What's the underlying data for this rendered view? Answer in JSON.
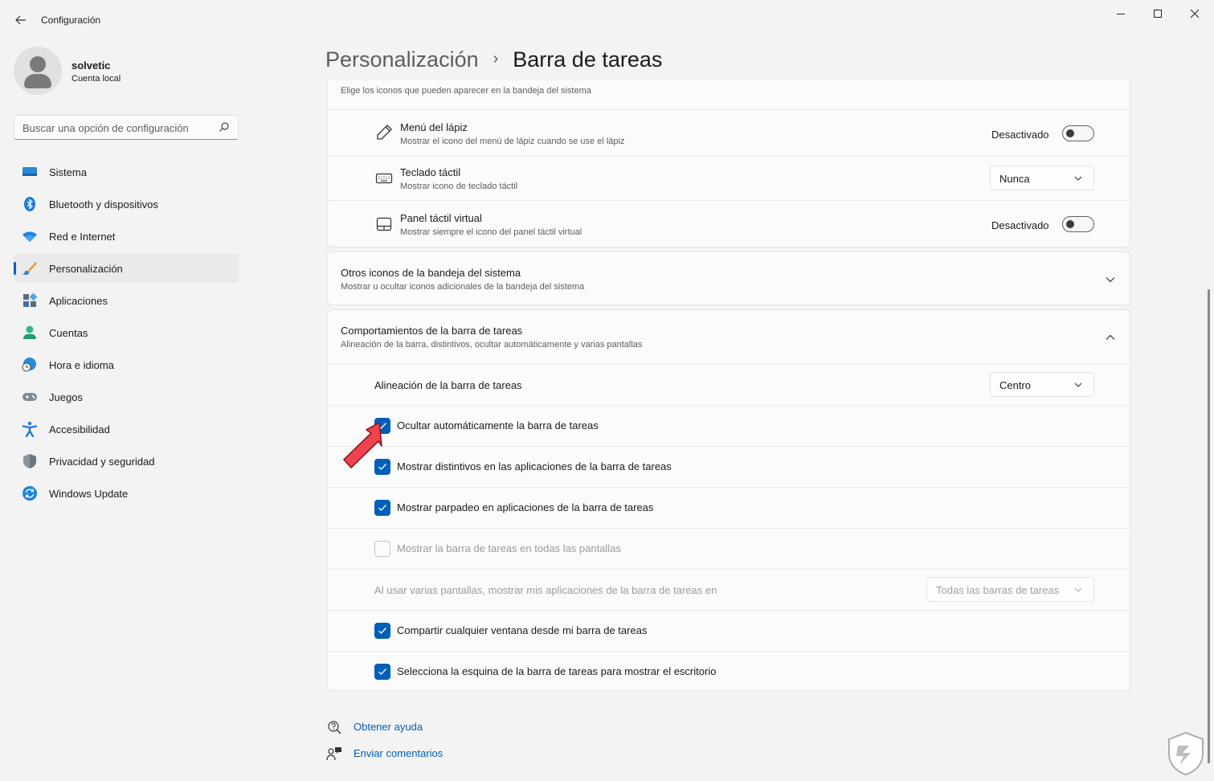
{
  "window": {
    "title": "Configuración"
  },
  "user": {
    "name": "solvetic",
    "account_type": "Cuenta local"
  },
  "search": {
    "placeholder": "Buscar una opción de configuración"
  },
  "sidebar": {
    "items": [
      {
        "label": "Sistema",
        "icon": "monitor-icon"
      },
      {
        "label": "Bluetooth y dispositivos",
        "icon": "bluetooth-icon"
      },
      {
        "label": "Red e Internet",
        "icon": "wifi-icon"
      },
      {
        "label": "Personalización",
        "icon": "brush-icon",
        "active": true
      },
      {
        "label": "Aplicaciones",
        "icon": "apps-icon"
      },
      {
        "label": "Cuentas",
        "icon": "person-icon"
      },
      {
        "label": "Hora e idioma",
        "icon": "globe-clock-icon"
      },
      {
        "label": "Juegos",
        "icon": "gamepad-icon"
      },
      {
        "label": "Accesibilidad",
        "icon": "accessibility-icon"
      },
      {
        "label": "Privacidad y seguridad",
        "icon": "shield-icon"
      },
      {
        "label": "Windows Update",
        "icon": "update-icon"
      }
    ]
  },
  "breadcrumb": {
    "parent": "Personalización",
    "separator": "›",
    "current": "Barra de tareas"
  },
  "tray_icons": {
    "description": "Elige los iconos que pueden aparecer en la bandeja del sistema",
    "items": [
      {
        "title": "Menú del lápiz",
        "subtitle": "Mostrar el icono del menú de lápiz cuando se use el lápiz",
        "control": "toggle",
        "value": "Desactivado",
        "on": false
      },
      {
        "title": "Teclado táctil",
        "subtitle": "Mostrar icono de teclado táctil",
        "control": "dropdown",
        "value": "Nunca"
      },
      {
        "title": "Panel táctil virtual",
        "subtitle": "Mostrar siempre el icono del panel táctil virtual",
        "control": "toggle",
        "value": "Desactivado",
        "on": false
      }
    ]
  },
  "other_tray": {
    "title": "Otros iconos de la bandeja del sistema",
    "subtitle": "Mostrar u ocultar iconos adicionales de la bandeja del sistema",
    "expanded": false
  },
  "behaviors": {
    "title": "Comportamientos de la barra de tareas",
    "subtitle": "Alineación de la barra, distintivos, ocultar automáticamente y varias pantallas",
    "expanded": true,
    "alignment": {
      "label": "Alineación de la barra de tareas",
      "value": "Centro"
    },
    "options": [
      {
        "label": "Ocultar automáticamente la barra de tareas",
        "checked": true,
        "enabled": true
      },
      {
        "label": "Mostrar distintivos en las aplicaciones de la barra de tareas",
        "checked": true,
        "enabled": true
      },
      {
        "label": "Mostrar parpadeo en aplicaciones de la barra de tareas",
        "checked": true,
        "enabled": true
      },
      {
        "label": "Mostrar la barra de tareas en todas las pantallas",
        "checked": false,
        "enabled": false
      }
    ],
    "multi_display": {
      "label": "Al usar varias pantallas, mostrar mis aplicaciones de la barra de tareas en",
      "value": "Todas las barras de tareas",
      "enabled": false
    },
    "options2": [
      {
        "label": "Compartir cualquier ventana desde mi barra de tareas",
        "checked": true,
        "enabled": true
      },
      {
        "label": "Selecciona la esquina de la barra de tareas para mostrar el escritorio",
        "checked": true,
        "enabled": true
      }
    ]
  },
  "footer": {
    "help": "Obtener ayuda",
    "feedback": "Enviar comentarios"
  },
  "colors": {
    "accent": "#005fb8",
    "annotation_arrow": "#f0434e"
  }
}
